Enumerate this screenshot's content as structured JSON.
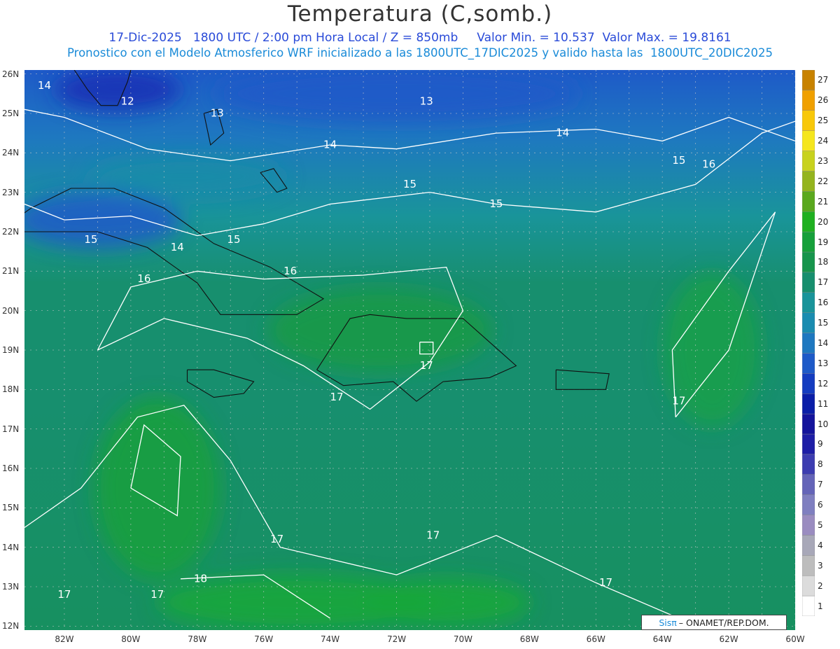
{
  "header": {
    "title": "Temperatura (C,somb.)",
    "subtitle_date": "17-Dic-2025",
    "subtitle_time": "1800 UTC / 2:00 pm Hora Local / Z = 850mb",
    "min_label": "Valor Min. = 10.537",
    "max_label": "Valor Max. = 19.8161",
    "model_info": "Pronostico con el Modelo Atmosferico WRF inicializado a las 1800UTC_17DIC2025 y valido hasta las  1800UTC_20DIC2025"
  },
  "map": {
    "lon_range": [
      -83.2,
      -60
    ],
    "lat_range": [
      11.9,
      26.1
    ],
    "lat_labels": [
      "26N",
      "25N",
      "24N",
      "23N",
      "22N",
      "21N",
      "20N",
      "19N",
      "18N",
      "17N",
      "16N",
      "15N",
      "14N",
      "13N",
      "12N"
    ],
    "lon_labels": [
      "82W",
      "80W",
      "78W",
      "76W",
      "74W",
      "72W",
      "70W",
      "68W",
      "66W",
      "64W",
      "62W",
      "60W"
    ],
    "contour_labels": [
      {
        "text": "14",
        "lon": -82.6,
        "lat": 25.7
      },
      {
        "text": "12",
        "lon": -80.1,
        "lat": 25.3
      },
      {
        "text": "13",
        "lon": -77.4,
        "lat": 25.0
      },
      {
        "text": "13",
        "lon": -71.1,
        "lat": 25.3
      },
      {
        "text": "14",
        "lon": -74.0,
        "lat": 24.2
      },
      {
        "text": "14",
        "lon": -67.0,
        "lat": 24.5
      },
      {
        "text": "15",
        "lon": -71.6,
        "lat": 23.2
      },
      {
        "text": "15",
        "lon": -69.0,
        "lat": 22.7
      },
      {
        "text": "15",
        "lon": -63.5,
        "lat": 23.8
      },
      {
        "text": "16",
        "lon": -62.6,
        "lat": 23.7
      },
      {
        "text": "15",
        "lon": -76.9,
        "lat": 21.8
      },
      {
        "text": "15",
        "lon": -81.2,
        "lat": 21.8
      },
      {
        "text": "14",
        "lon": -78.6,
        "lat": 21.6
      },
      {
        "text": "16",
        "lon": -75.2,
        "lat": 21.0
      },
      {
        "text": "16",
        "lon": -79.6,
        "lat": 20.8
      },
      {
        "text": "17",
        "lon": -71.1,
        "lat": 18.6
      },
      {
        "text": "17",
        "lon": -73.8,
        "lat": 17.8
      },
      {
        "text": "17",
        "lon": -63.5,
        "lat": 17.7
      },
      {
        "text": "17",
        "lon": -75.6,
        "lat": 14.2
      },
      {
        "text": "17",
        "lon": -70.9,
        "lat": 14.3
      },
      {
        "text": "17",
        "lon": -65.7,
        "lat": 13.1
      },
      {
        "text": "18",
        "lon": -77.9,
        "lat": 13.2
      },
      {
        "text": "17",
        "lon": -79.2,
        "lat": 12.8
      },
      {
        "text": "17",
        "lon": -82.0,
        "lat": 12.8
      }
    ]
  },
  "colorbar": {
    "ticks": [
      "1",
      "2",
      "3",
      "4",
      "5",
      "6",
      "7",
      "8",
      "9",
      "10",
      "11",
      "12",
      "13",
      "14",
      "15",
      "16",
      "17",
      "18",
      "19",
      "20",
      "21",
      "22",
      "23",
      "24",
      "25",
      "26",
      "27"
    ],
    "colors": [
      "#ffffff",
      "#dcdcdc",
      "#bdbdbd",
      "#a8a8b8",
      "#9a8cc0",
      "#7f7fc0",
      "#6464b8",
      "#3c3cb0",
      "#1e1ea6",
      "#14149c",
      "#0a1ea8",
      "#143cc0",
      "#1e5ac8",
      "#1e78c0",
      "#1a8cb0",
      "#19949a",
      "#178f6e",
      "#17954c",
      "#16a03a",
      "#1fb020",
      "#5aa81e",
      "#94b41e",
      "#c8d21e",
      "#f5e61e",
      "#f8c80a",
      "#f0a000",
      "#c88200"
    ]
  },
  "credit": {
    "brand": "Sisπ",
    "text": "– ONAMET/REP.DOM."
  }
}
